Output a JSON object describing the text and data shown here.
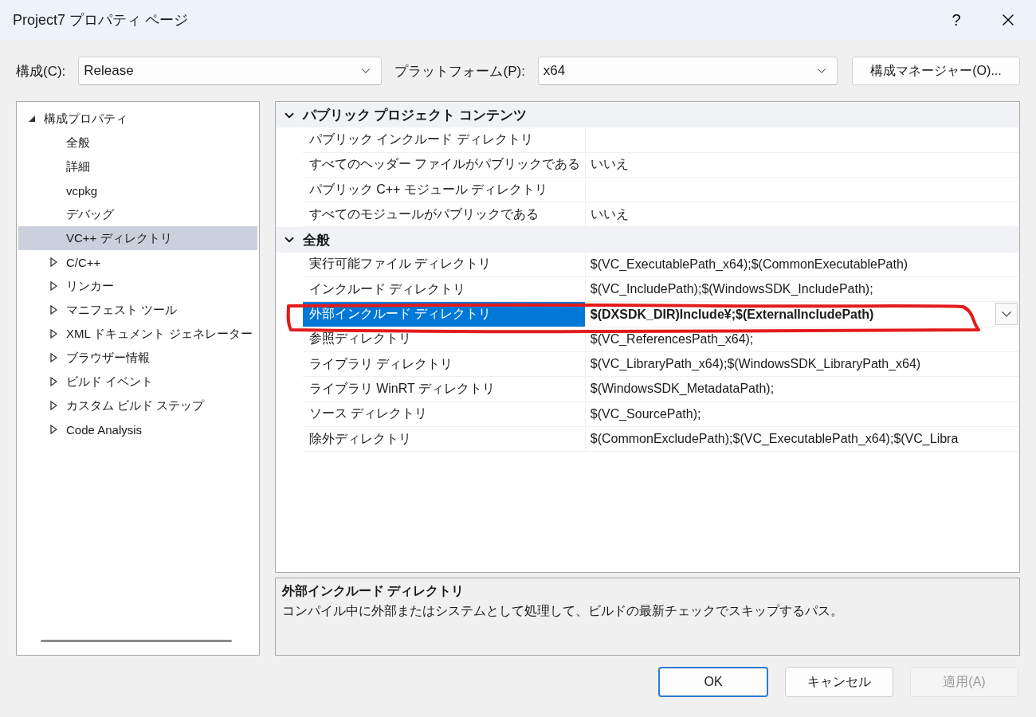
{
  "window": {
    "title": "Project7 プロパティ ページ",
    "help": "?"
  },
  "toolbar": {
    "configuration_label": "構成(C):",
    "configuration": "Release",
    "platform_label": "プラットフォーム(P):",
    "platform": "x64",
    "manager_button": "構成マネージャー(O)..."
  },
  "tree": [
    {
      "label": "構成プロパティ",
      "expanded": true,
      "selected": false,
      "children": [
        {
          "label": "全般",
          "selected": false
        },
        {
          "label": "詳細",
          "selected": false
        },
        {
          "label": "vcpkg",
          "selected": false
        },
        {
          "label": "デバッグ",
          "selected": false
        },
        {
          "label": "VC++ ディレクトリ",
          "selected": true
        },
        {
          "label": "C/C++",
          "expanded": false,
          "selected": false
        },
        {
          "label": "リンカー",
          "expanded": false,
          "selected": false
        },
        {
          "label": "マニフェスト ツール",
          "expanded": false,
          "selected": false
        },
        {
          "label": "XML ドキュメント ジェネレーター",
          "expanded": false,
          "selected": false
        },
        {
          "label": "ブラウザー情報",
          "expanded": false,
          "selected": false
        },
        {
          "label": "ビルド イベント",
          "expanded": false,
          "selected": false
        },
        {
          "label": "カスタム ビルド ステップ",
          "expanded": false,
          "selected": false
        },
        {
          "label": "Code Analysis",
          "expanded": false,
          "selected": false
        }
      ]
    }
  ],
  "grid": [
    {
      "label": "パブリック プロジェクト コンテンツ",
      "expanded": true,
      "properties": [
        {
          "name": "パブリック インクルード ディレクトリ",
          "selected": false,
          "modified": false
        },
        {
          "name": "すべてのヘッダー ファイルがパブリックである",
          "value": "いいえ",
          "selected": false,
          "modified": false
        },
        {
          "name": "パブリック C++ モジュール ディレクトリ",
          "selected": false,
          "modified": false
        },
        {
          "name": "すべてのモジュールがパブリックである",
          "value": "いいえ",
          "selected": false,
          "modified": false
        }
      ]
    },
    {
      "label": "全般",
      "expanded": true,
      "properties": [
        {
          "name": "実行可能ファイル ディレクトリ",
          "value": "$(VC_ExecutablePath_x64);$(CommonExecutablePath)",
          "selected": false,
          "modified": false
        },
        {
          "name": "インクルード ディレクトリ",
          "value": "$(VC_IncludePath);$(WindowsSDK_IncludePath);",
          "selected": false,
          "modified": false
        },
        {
          "name": "外部インクルード ディレクトリ",
          "value": "$(DXSDK_DIR)Include¥;$(ExternalIncludePath)",
          "selected": true,
          "modified": true
        },
        {
          "name": "参照ディレクトリ",
          "value": "$(VC_ReferencesPath_x64);",
          "selected": false,
          "modified": false
        },
        {
          "name": "ライブラリ ディレクトリ",
          "value": "$(VC_LibraryPath_x64);$(WindowsSDK_LibraryPath_x64)",
          "selected": false,
          "modified": false
        },
        {
          "name": "ライブラリ WinRT ディレクトリ",
          "value": "$(WindowsSDK_MetadataPath);",
          "selected": false,
          "modified": false
        },
        {
          "name": "ソース ディレクトリ",
          "value": "$(VC_SourcePath);",
          "selected": false,
          "modified": false
        },
        {
          "name": "除外ディレクトリ",
          "value": "$(CommonExcludePath);$(VC_ExecutablePath_x64);$(VC_Libra",
          "selected": false,
          "modified": false
        }
      ]
    }
  ],
  "description": {
    "title": "外部インクルード ディレクトリ",
    "text": "コンパイル中に外部またはシステムとして処理して、ビルドの最新チェックでスキップするパス。"
  },
  "buttons": [
    {
      "label": "OK",
      "default": true,
      "disabled": false
    },
    {
      "label": "キャンセル",
      "default": false,
      "disabled": false
    },
    {
      "label": "適用(A)",
      "default": false,
      "disabled": true
    }
  ]
}
